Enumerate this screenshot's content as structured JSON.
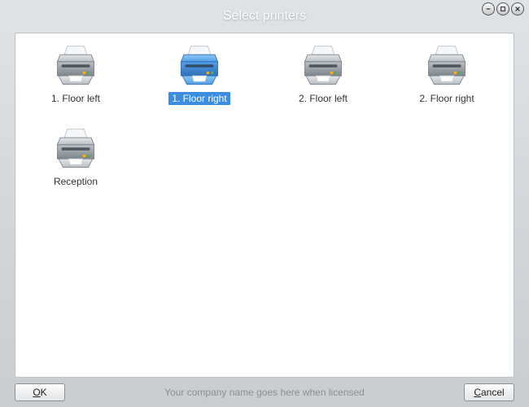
{
  "window": {
    "title": "Select printers"
  },
  "printers": [
    {
      "label": "1. Floor left",
      "selected": false
    },
    {
      "label": "1. Floor right",
      "selected": true
    },
    {
      "label": "2. Floor left",
      "selected": false
    },
    {
      "label": "2. Floor right",
      "selected": false
    },
    {
      "label": "Reception",
      "selected": false
    }
  ],
  "buttons": {
    "ok": "OK",
    "cancel": "Cancel"
  },
  "footer": {
    "license_text": "Your company name goes here when licensed"
  },
  "colors": {
    "selection": "#3a8de0",
    "titlebar_text": "#ffffff"
  }
}
